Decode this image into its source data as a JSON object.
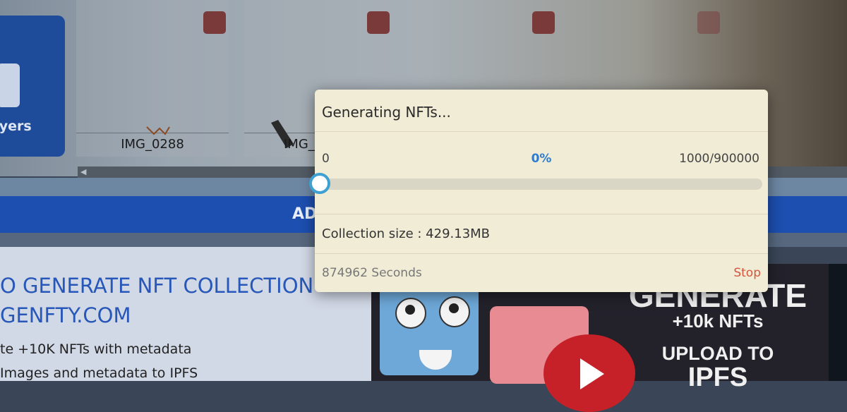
{
  "sidebar": {
    "layers_label": "layers",
    "camera_icon": "camera-icon"
  },
  "thumbnails": [
    {
      "name": "IMG_0288"
    },
    {
      "name": "IMG_"
    }
  ],
  "add_button": {
    "label": "AD"
  },
  "info": {
    "title": "O GENERATE NFT COLLECTION",
    "site": "GENFTY.COM",
    "line1": "te +10K NFTs with metadata",
    "line2": "Images and metadata to IPFS"
  },
  "banner": {
    "line1": "GENERATE",
    "line2": "+10k NFTs",
    "line3": "UPLOAD TO",
    "line4": "IPFS",
    "play_icon": "play-icon"
  },
  "modal": {
    "title": "Generating NFTs...",
    "progress_min": "0",
    "progress_percent_label": "0%",
    "progress_max": "1000/900000",
    "progress_value": 0,
    "collection_size": "Collection size : 429.13MB",
    "seconds": "874962 Seconds",
    "stop_label": "Stop",
    "accent_color": "#3fa1d2",
    "stop_color": "#d4543e"
  }
}
